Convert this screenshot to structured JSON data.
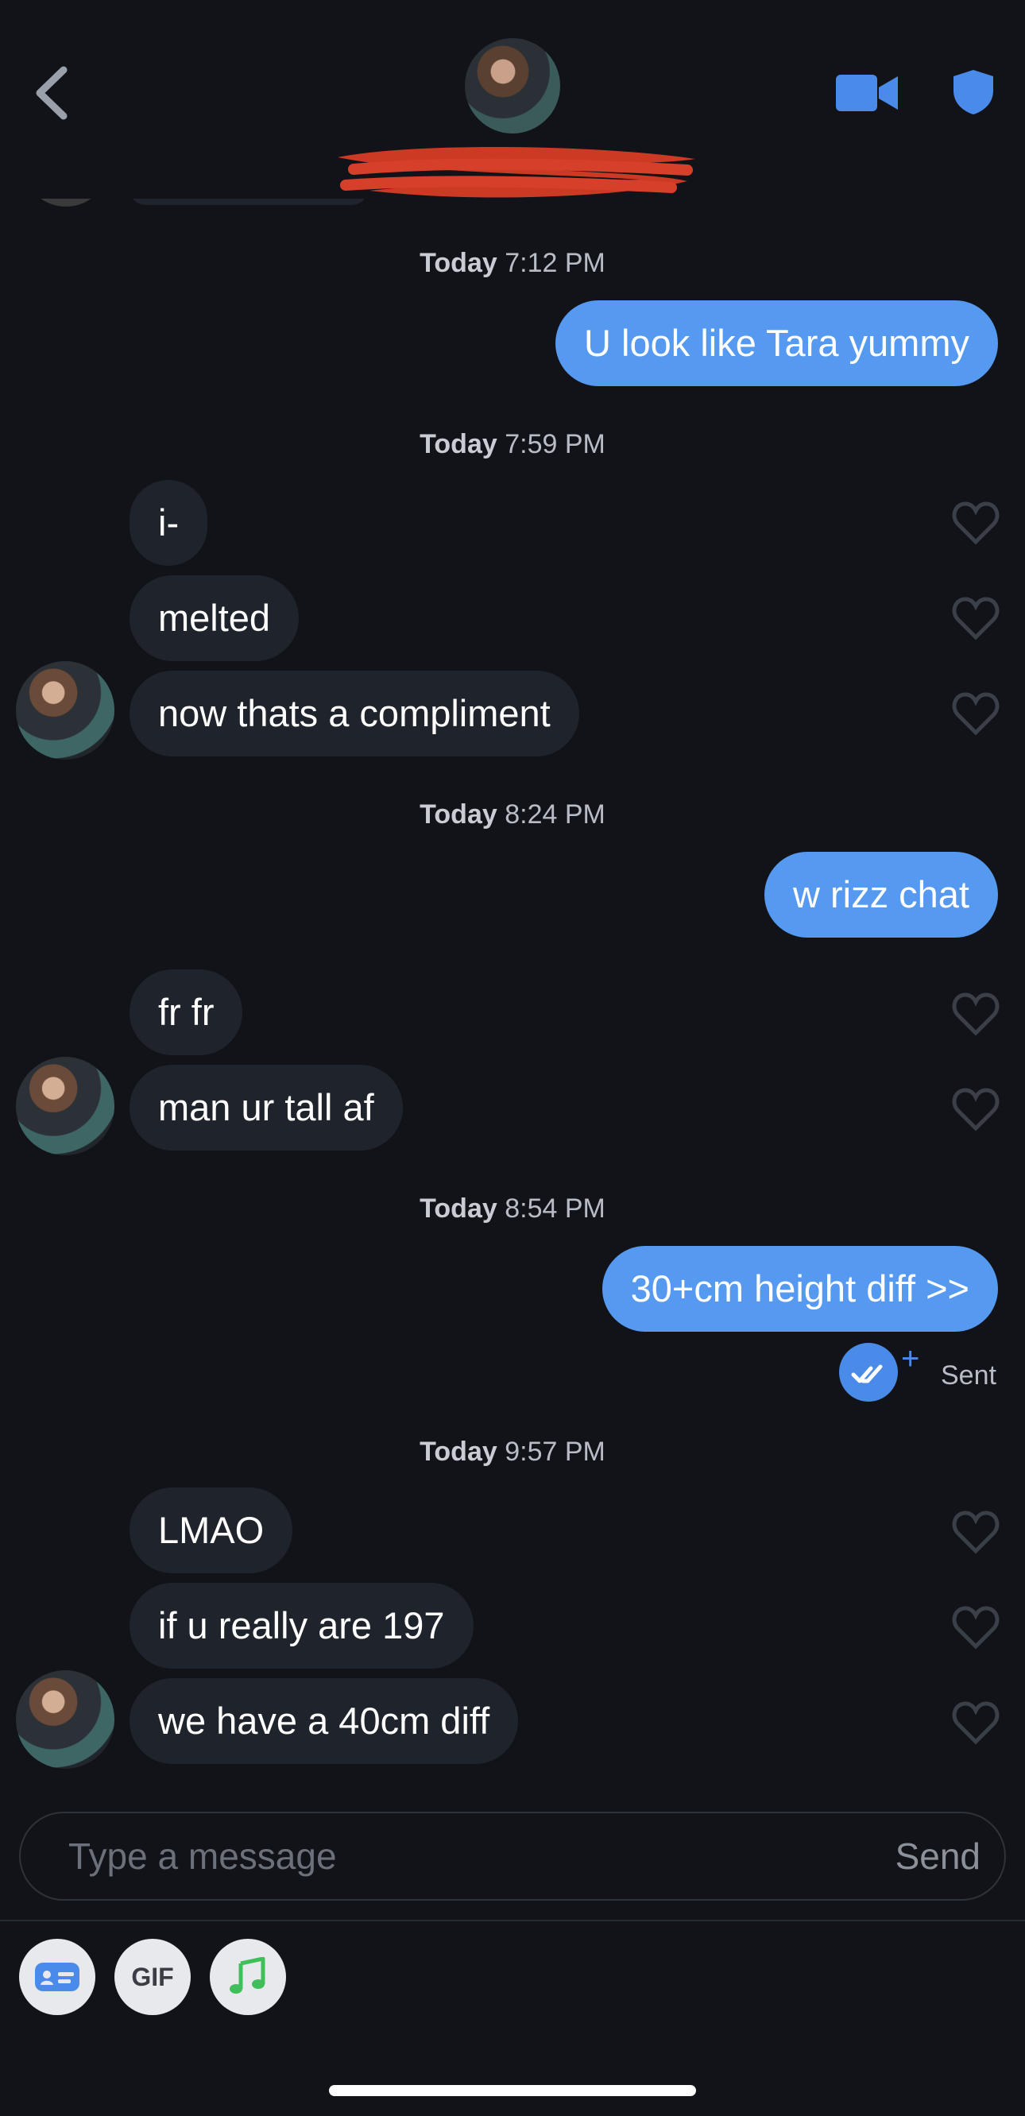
{
  "header": {
    "back_icon": "chevron-left-icon",
    "video_icon": "video-camera-icon",
    "shield_icon": "shield-icon",
    "accent_color": "#4a8ae8"
  },
  "messages": {
    "t1": {
      "day": "Today",
      "time": "7:12 PM"
    },
    "m1": "U look like Tara yummy",
    "t2": {
      "day": "Today",
      "time": "7:59 PM"
    },
    "m2": "i-",
    "m3": "melted",
    "m4": "now thats a compliment",
    "t3": {
      "day": "Today",
      "time": "8:24 PM"
    },
    "m5": "w rizz chat",
    "m6": "fr fr",
    "m7": "man ur tall af",
    "t4": {
      "day": "Today",
      "time": "8:54 PM"
    },
    "m8": "30+cm height diff >>",
    "sent_status": "Sent",
    "t5": {
      "day": "Today",
      "time": "9:57 PM"
    },
    "m9": "LMAO",
    "m10": "if u really are 197",
    "m11": "we have a 40cm diff"
  },
  "composer": {
    "placeholder": "Type a message",
    "send_label": "Send"
  },
  "toolbar": {
    "gif_label": "GIF",
    "card_icon": "id-card-icon",
    "music_icon": "music-note-icon"
  },
  "colors": {
    "background": "#111318",
    "incoming_bubble": "#1f232b",
    "outgoing_bubble": "#5599f0"
  }
}
